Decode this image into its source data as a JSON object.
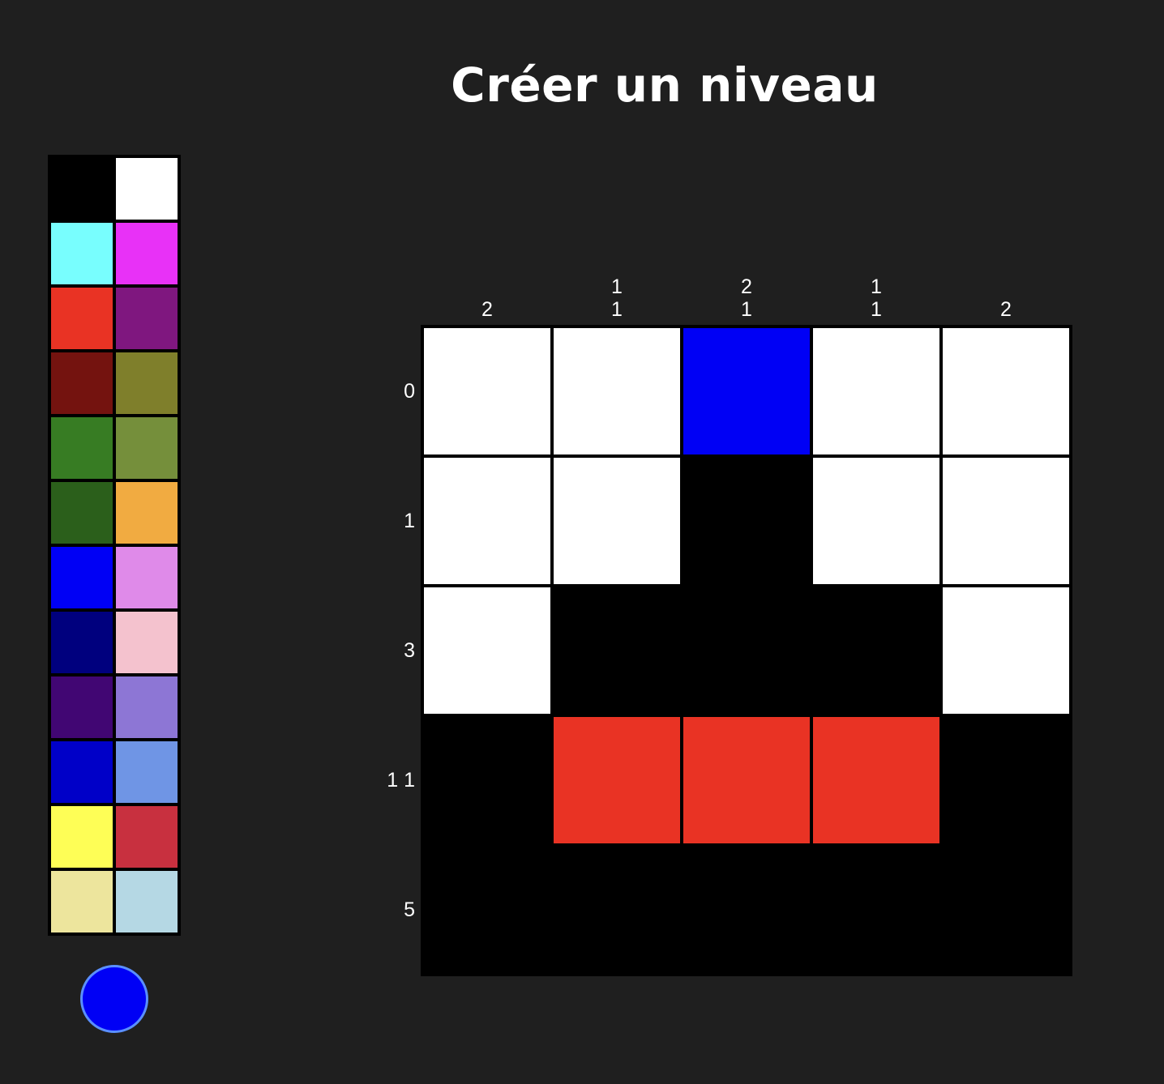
{
  "title": "Créer un niveau",
  "palette": [
    "#000000",
    "#ffffff",
    "#78fefe",
    "#e831f7",
    "#e93324",
    "#7f177f",
    "#74130f",
    "#7f7f2b",
    "#377c23",
    "#758f3b",
    "#2b5f1b",
    "#f1ab41",
    "#0000f5",
    "#df8ae9",
    "#00007e",
    "#f4c2ce",
    "#410673",
    "#8d76d5",
    "#0000c8",
    "#6f95e5",
    "#fefe56",
    "#c8303f",
    "#ede59d",
    "#b5d8e4"
  ],
  "selected_color": "#0000f5",
  "column_clues": [
    [
      "2"
    ],
    [
      "1",
      "1"
    ],
    [
      "2",
      "1"
    ],
    [
      "1",
      "1"
    ],
    [
      "2"
    ]
  ],
  "row_clues": [
    "0",
    "1",
    "3",
    "1 1",
    "5"
  ],
  "grid": [
    [
      "#ffffff",
      "#ffffff",
      "#0000f5",
      "#ffffff",
      "#ffffff"
    ],
    [
      "#ffffff",
      "#ffffff",
      "#000000",
      "#ffffff",
      "#ffffff"
    ],
    [
      "#ffffff",
      "#000000",
      "#000000",
      "#000000",
      "#ffffff"
    ],
    [
      "#000000",
      "#e93324",
      "#e93324",
      "#e93324",
      "#000000"
    ],
    [
      "#000000",
      "#000000",
      "#000000",
      "#000000",
      "#000000"
    ]
  ]
}
